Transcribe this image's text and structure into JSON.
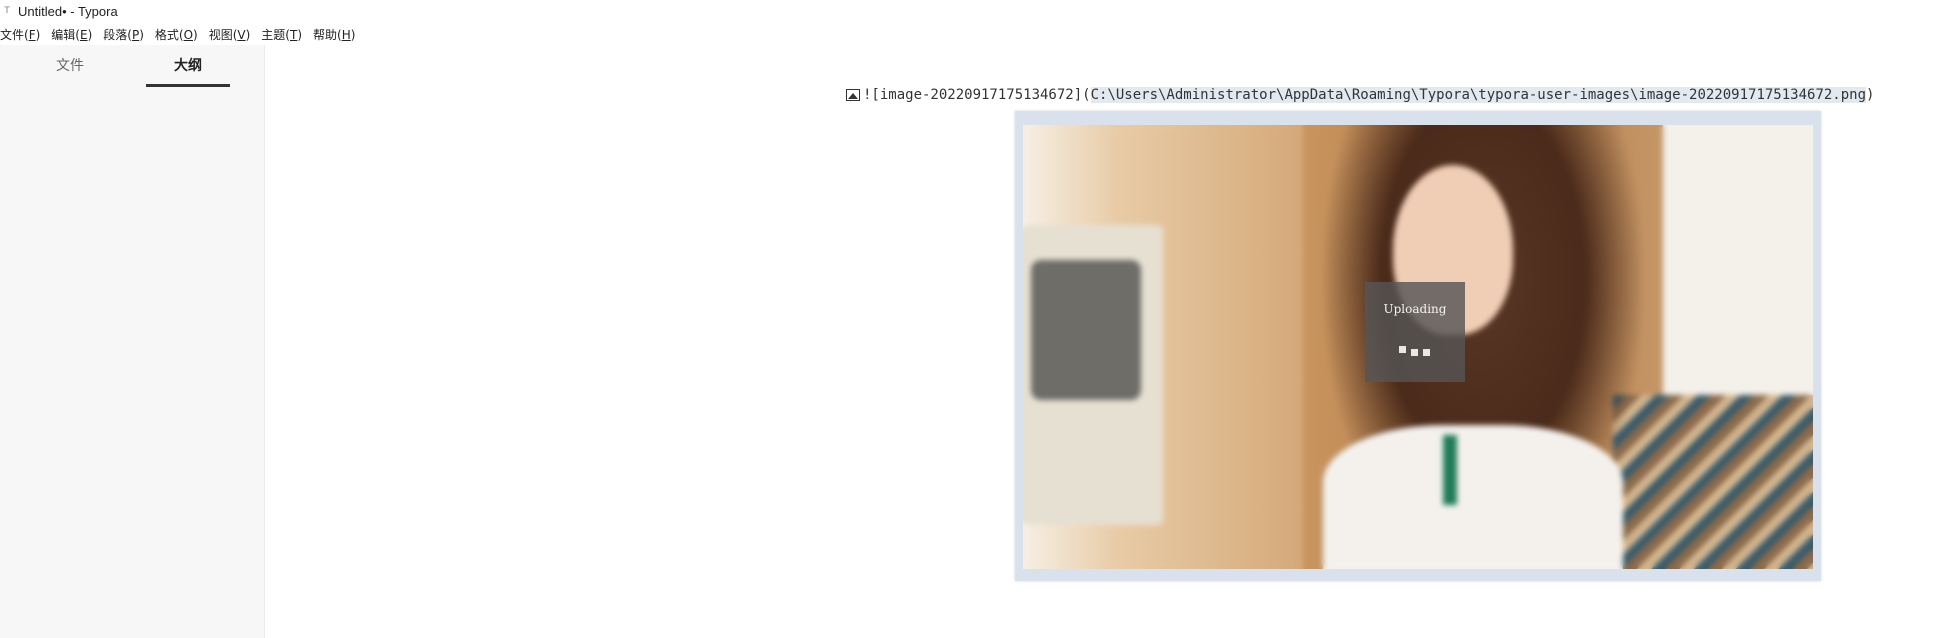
{
  "window": {
    "title": "Untitled• - Typora",
    "app_icon_glyph": "T",
    "app_icon_name": "typora-app-icon"
  },
  "menubar": {
    "items": [
      {
        "label": "文件(",
        "accel": "F",
        "close": ")"
      },
      {
        "label": "编辑(",
        "accel": "E",
        "close": ")"
      },
      {
        "label": "段落(",
        "accel": "P",
        "close": ")"
      },
      {
        "label": "格式(",
        "accel": "O",
        "close": ")"
      },
      {
        "label": "视图(",
        "accel": "V",
        "close": ")"
      },
      {
        "label": "主题(",
        "accel": "T",
        "close": ")"
      },
      {
        "label": "帮助(",
        "accel": "H",
        "close": ")"
      }
    ]
  },
  "sidebar": {
    "tabs": [
      {
        "label": "文件",
        "active": false
      },
      {
        "label": "大纲",
        "active": true
      }
    ]
  },
  "editor": {
    "markdown_prefix": "![image-20220917175134672](",
    "markdown_path": "C:\\Users\\Administrator\\AppData\\Roaming\\Typora\\typora-user-images\\image-20220917175134672.png",
    "markdown_suffix": ")",
    "image_icon_name": "image-icon",
    "upload_status": "Uploading"
  },
  "colors": {
    "sidebar_bg": "#f7f7f7",
    "path_highlight": "#e3e9f1",
    "upload_overlay": "#555555",
    "image_frame": "#d9e2ec"
  }
}
